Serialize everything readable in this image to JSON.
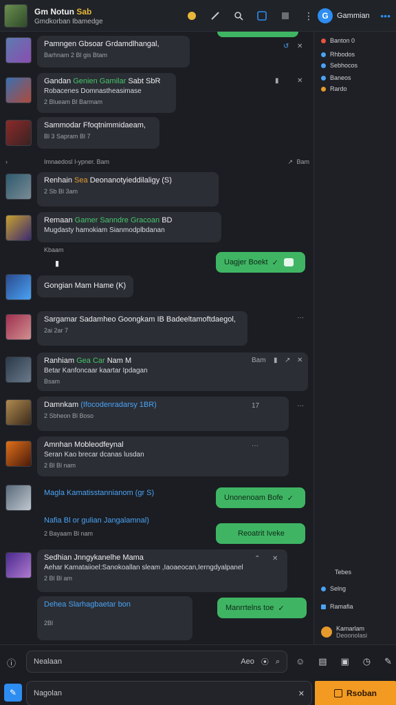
{
  "header": {
    "title_white": "Gm Notun",
    "title_yellow": "Sab",
    "subtitle": "Gmdkorban Ibamedge",
    "user_name": "Gammian"
  },
  "messages": [
    {
      "title": "Pamngen Gbsoar Grdamdlhangal,",
      "meta": "Barhnam  2  Bl gis  Btam"
    },
    {
      "title_a": "Gandan",
      "title_b": "Genien Gamilar",
      "title_c": "Sabt SbR",
      "line2": "Robacenes  Domnastheasimase",
      "meta": "2  Blueam  Bl  Barmam"
    },
    {
      "title": "Sammodar Ffoqtnimmidaeam,",
      "meta": "Bl  3 Sapram  Bl  7"
    },
    {
      "title_a": "Renhain",
      "title_b": "Sea",
      "title_c": "Deonanotyieddilaligy (S)",
      "meta": "2  Sb  Bl  3am"
    },
    {
      "title_a": "Remaan",
      "title_b": "Gamer Sanndre Gracoan",
      "title_c": "BD",
      "line2": "Mugdasty hamokiam Sianmodplbdanan",
      "meta": "Kbaam"
    },
    {
      "title": "Gongian Mam Hame (K)"
    },
    {
      "title": "Sargamar Sadamheo Goongkam IB Badeeltamoftdaegol,",
      "meta": "2ai  2ar  7"
    },
    {
      "title_a": "Ranhiam",
      "title_b": "Gea Car",
      "title_c": "Nam M",
      "line2": "Betar Kanfoncaar kaartar Ipdagan",
      "meta": "Bsam"
    },
    {
      "title_a": "Damnkam",
      "title_b": "(Ifocodenradarsy 1BR)",
      "meta": "2 Sbheon  Bl  Boso"
    },
    {
      "title": "Amnhan Mobleodfeynal",
      "line2": "Seran Kao brecar dcanas lusdan",
      "meta": "2  Bl  Bl nam"
    },
    {
      "title": "Magla Kamatisstannianom (gr S)"
    },
    {
      "title": "Nafia Bl or gulian Jangalamnal)",
      "meta": "2 Bayaam  Bl nam"
    },
    {
      "title": "Sedhian Jnngykanelhe Mama",
      "line2": "Aehar Kamataiioel:Sanokoallan sleam ,Iaoaeocan,Ierngdyalpanel",
      "meta": "2  Bl  Bl am"
    },
    {
      "title_a": "Dehea",
      "title_b": "Slarhagbaetar bon",
      "meta": "2Bl"
    }
  ],
  "separator": {
    "text": "Imnaedosl I-ypner. Bam",
    "right": "Bam"
  },
  "corners": [
    "Bam",
    "Bl",
    "17"
  ],
  "outgoing": [
    {
      "label": "Uagjer Boekt"
    },
    {
      "label": "Unonenoam Bofe"
    },
    {
      "label": "Reoatrit Iveke"
    },
    {
      "label": "Manrrtelns toe"
    }
  ],
  "sidebar": {
    "items": [
      {
        "label": "Banton 0",
        "color": "#e5553d"
      },
      {
        "label": "Rhbodos",
        "color": "#4aa3f5"
      },
      {
        "label": "Sebhocos",
        "color": "#4aa3f5"
      },
      {
        "label": "Baneos",
        "color": "#4aa3f5"
      },
      {
        "label": "Rardo",
        "color": "#e79a2c"
      }
    ],
    "footer": {
      "heading": "Tebes",
      "item1": "Selng",
      "item2": "Ramafia",
      "user": "Kamarlam",
      "user_sub": "Deoonolasi"
    }
  },
  "input": {
    "placeholder": "Nealaan",
    "suffix": "Aeo",
    "placeholder2": "Nagolan",
    "send": "Rsoban"
  }
}
